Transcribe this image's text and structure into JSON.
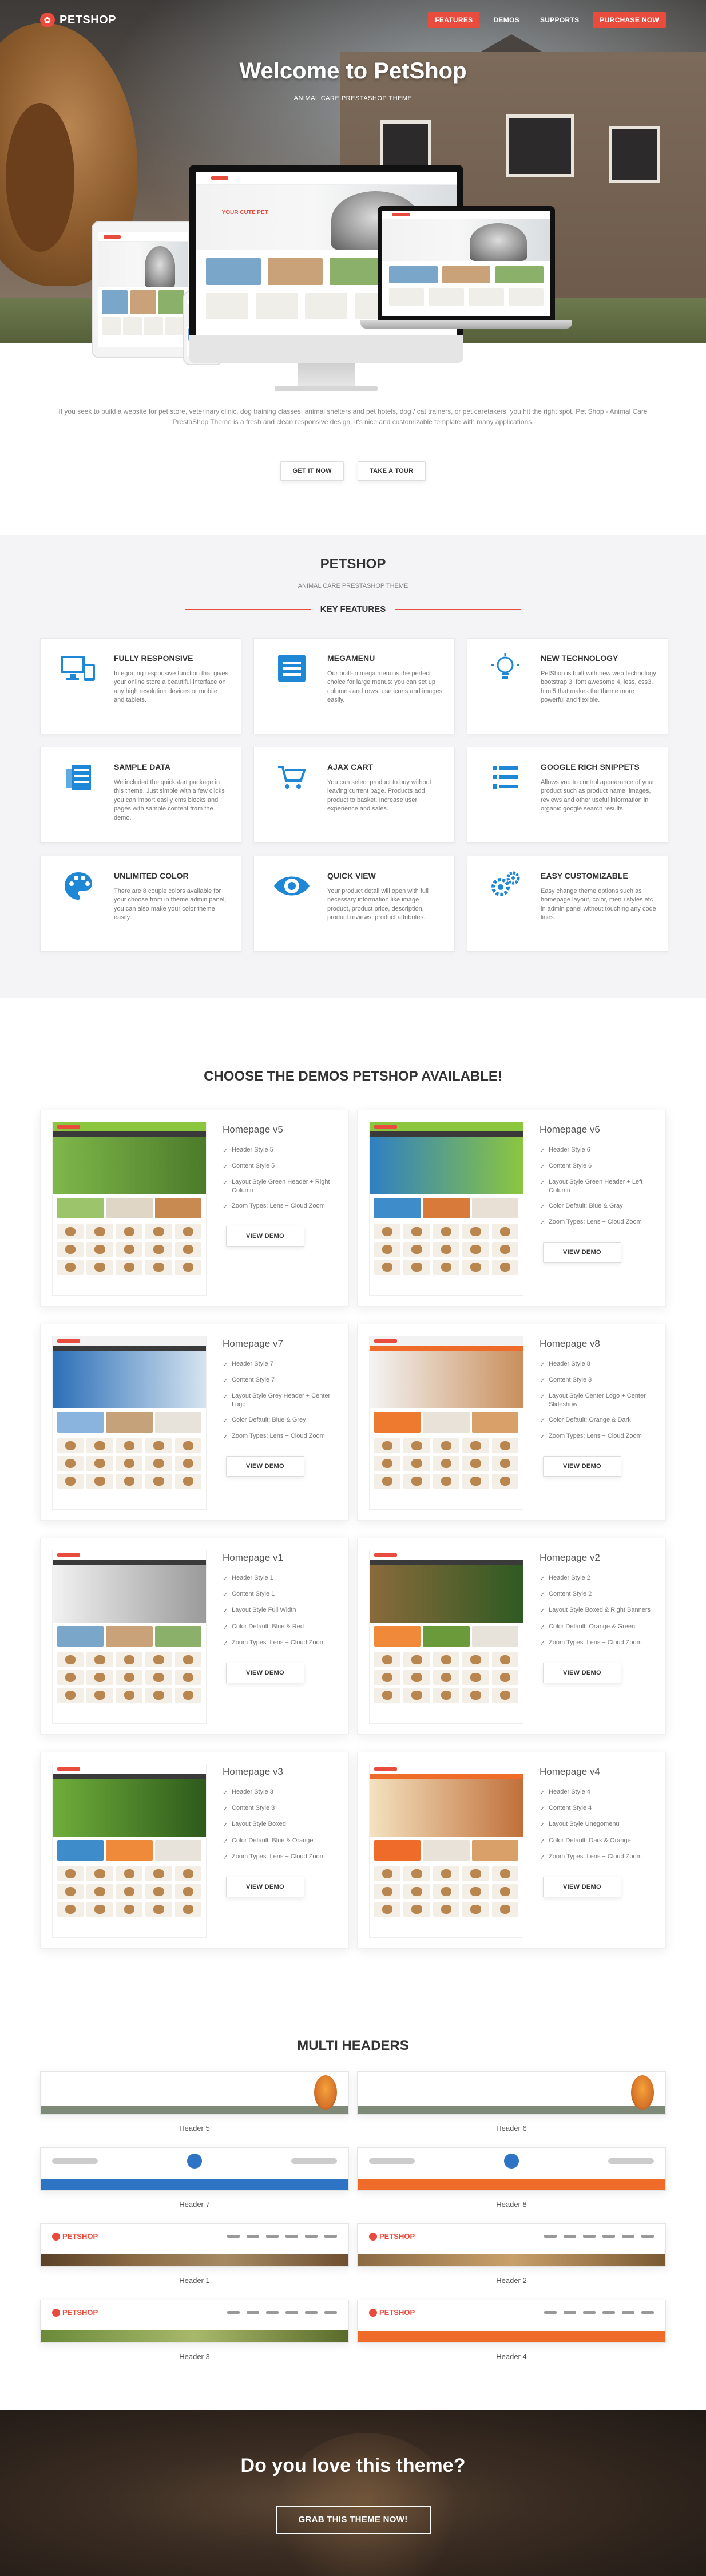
{
  "brand": {
    "logo_text": "PETSHOP",
    "accent": "#e94b3c"
  },
  "nav": {
    "items": [
      {
        "label": "FEATURES",
        "active": true
      },
      {
        "label": "DEMOS",
        "active": false
      },
      {
        "label": "SUPPORTS",
        "active": false
      },
      {
        "label": "PURCHASE NOW",
        "active": false
      }
    ]
  },
  "hero": {
    "title": "Welcome to PetShop",
    "subtitle": "ANIMAL CARE PRESTASHOP THEME",
    "mock_banner": "YOUR CUTE PET"
  },
  "intro": {
    "text": "If you seek to build a website for pet store, veterinary clinic, dog training classes, animal shelters and pet hotels, dog / cat trainers, or pet caretakers, you hit the right spot. Pet Shop - Animal Care PrestaShop Theme is a fresh and clean responsive design. It's nice and customizable template with many applications.",
    "btn_get": "GET IT NOW",
    "btn_tour": "TAKE A TOUR"
  },
  "features": {
    "title": "PETSHOP",
    "subtitle": "ANIMAL CARE PRESTASHOP THEME",
    "heading": "KEY FEATURES",
    "items": [
      {
        "title": "FULLY RESPONSIVE",
        "icon": "devices-icon",
        "text": "Integrating responsive function that gives your online store a beautiful interface on any high resolution devices or mobile and tablets."
      },
      {
        "title": "MEGAMENU",
        "icon": "menu-icon",
        "text": "Our built-in mega menu is the perfect choice for large menus: you can set up columns and rows, use icons and images easily."
      },
      {
        "title": "NEW TECHNOLOGY",
        "icon": "bulb-icon",
        "text": "PetShop is built with new web technology bootstrap 3, font awesome 4, less, css3, html5 that makes the theme more powerful and flexible."
      },
      {
        "title": "SAMPLE DATA",
        "icon": "database-icon",
        "text": "We included the quickstart package in this theme. Just simple with a few clicks you can import easily cms blocks and pages with sample content from the demo."
      },
      {
        "title": "AJAX CART",
        "icon": "cart-icon",
        "text": "You can select product to buy without leaving current page. Products add product to basket. Increase user experience and sales."
      },
      {
        "title": "GOOGLE RICH SNIPPETS",
        "icon": "list-icon",
        "text": "Allows you to control appearance of your product such as product name, images, reviews and other useful information in organic google search results."
      },
      {
        "title": "UNLIMITED COLOR",
        "icon": "palette-icon",
        "text": "There are 8 couple colors available for your choose from in theme admin panel, you can also make your color theme easily."
      },
      {
        "title": "QUICK VIEW",
        "icon": "eye-icon",
        "text": "Your product detail will open with full necessary information like image product, product price, description, product reviews, product attributes."
      },
      {
        "title": "EASY CUSTOMIZABLE",
        "icon": "gears-icon",
        "text": "Easy change theme options such as homepage layout, color, menu styles etc in admin panel without touching any code lines."
      }
    ]
  },
  "demos": {
    "title": "CHOOSE THE DEMOS PETSHOP AVAILABLE!",
    "btn": "VIEW DEMO",
    "items": [
      {
        "name": "Homepage v5",
        "features": [
          "Header Style 5",
          "Content Style 5",
          "Layout Style Green Header + Right Column",
          "Zoom Types: Lens + Cloud Zoom"
        ]
      },
      {
        "name": "Homepage v6",
        "features": [
          "Header Style 6",
          "Content Style 6",
          "Layout Style Green Header + Left Column",
          "Color Default: Blue & Gray",
          "Zoom Types: Lens + Cloud Zoom"
        ]
      },
      {
        "name": "Homepage v7",
        "features": [
          "Header Style 7",
          "Content Style 7",
          "Layout Style Grey Header + Center Logo",
          "Color Default: Blue & Grey",
          "Zoom Types: Lens + Cloud Zoom"
        ]
      },
      {
        "name": "Homepage v8",
        "features": [
          "Header Style 8",
          "Content Style 8",
          "Layout Style Center Logo + Center Slideshow",
          "Color Default: Orange & Dark",
          "Zoom Types: Lens + Cloud Zoom"
        ]
      },
      {
        "name": "Homepage v1",
        "features": [
          "Header Style 1",
          "Content Style 1",
          "Layout Style Full Width",
          "Color Default: Blue & Red",
          "Zoom Types: Lens + Cloud Zoom"
        ]
      },
      {
        "name": "Homepage v2",
        "features": [
          "Header Style 2",
          "Content Style 2",
          "Layout Style Boxed & Right Banners",
          "Color Default: Orange & Green",
          "Zoom Types: Lens + Cloud Zoom"
        ]
      },
      {
        "name": "Homepage v3",
        "features": [
          "Header Style 3",
          "Content Style 3",
          "Layout Style Boxed",
          "Color Default: Blue & Orange",
          "Zoom Types: Lens + Cloud Zoom"
        ]
      },
      {
        "name": "Homepage v4",
        "features": [
          "Header Style 4",
          "Content Style 4",
          "Layout Style Unegomenu",
          "Color Default: Dark & Orange",
          "Zoom Types: Lens + Cloud Zoom"
        ]
      }
    ]
  },
  "multi_headers": {
    "title": "MULTI HEADERS",
    "items": [
      "Header 5",
      "Header 6",
      "Header 7",
      "Header 8",
      "Header 1",
      "Header 2",
      "Header 3",
      "Header 4"
    ]
  },
  "cta": {
    "title": "Do you love this theme?",
    "btn": "GRAB THIS THEME NOW!"
  }
}
